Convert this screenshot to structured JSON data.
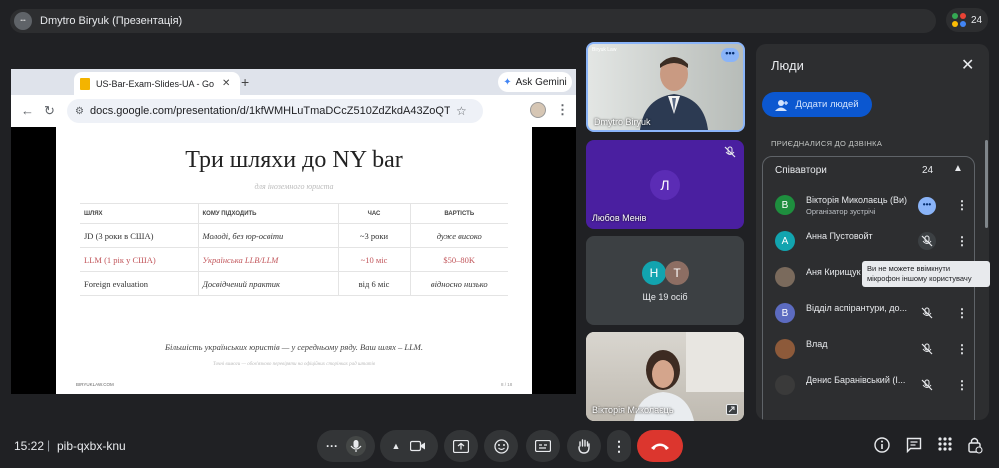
{
  "top_bar": {
    "presenter_label": "Dmytro Biryuk (Презентація)",
    "participant_count": "24"
  },
  "browser": {
    "tab_title": "US-Bar-Exam-Slides-UA - Go",
    "gemini_label": "Ask Gemini",
    "url": "docs.google.com/presentation/d/1kfWMHLuTmaDCcZ510ZdZkdA43ZoQTQ_Kd..."
  },
  "slide": {
    "title": "Три шляхи до NY bar",
    "subtitle": "для іноземного юриста",
    "headers": [
      "ШЛЯХ",
      "КОМУ ПІДХОДИТЬ",
      "ЧАС",
      "ВАРТІСТЬ"
    ],
    "rows": [
      [
        "JD (3 роки в США)",
        "Молоді, без юр-освіти",
        "~3 роки",
        "дуже високо"
      ],
      [
        "LLM (1 рік у США)",
        "Українська LLB/LLM",
        "~10 міс",
        "$50–80K"
      ],
      [
        "Foreign evaluation",
        "Досвідчений практик",
        "від 6 міс",
        "відносно низько"
      ]
    ],
    "footer_text": "Більшість українських юристів — у середньому ряду. Ваш шлях – LLM.",
    "note": "Точні вимоги — обов'язково перевіряти на офіційних сторінках рад штатів",
    "brand": "BIRYUKLAW.COM",
    "page": "8 / 18"
  },
  "tiles": [
    {
      "name": "Dmytro Biryuk",
      "label_small": "Biryuk Law"
    },
    {
      "name": "Любов Менів",
      "initial": "Л"
    },
    {
      "name": "Ще 19 осіб",
      "initials": [
        "Н",
        "Т"
      ]
    },
    {
      "name": "Вікторія Миколаєць"
    }
  ],
  "people_panel": {
    "title": "Люди",
    "add_people_label": "Додати людей",
    "joined_label": "ПРИЄДНАЛИСЯ ДО ДЗВІНКА",
    "group_title": "Співавтори",
    "group_count": "24",
    "people": [
      {
        "initial": "В",
        "name": "Вікторія Миколаєць (Ви)",
        "role": "Організатор зустрічі",
        "color": "#1e8e3e"
      },
      {
        "initial": "А",
        "name": "Анна Пустовойт",
        "role": "",
        "color": "#12a4af"
      },
      {
        "initial": "",
        "name": "Аня Кирищук",
        "role": "",
        "color": "#7a6a5c"
      },
      {
        "initial": "В",
        "name": "Відділ аспірантури, до...",
        "role": "",
        "color": "#5c6bc0"
      },
      {
        "initial": "",
        "name": "Влад",
        "role": "",
        "color": "#8d5a3a"
      },
      {
        "initial": "",
        "name": "Денис Баранівський (І...",
        "role": "",
        "color": "#3a3a3a"
      }
    ],
    "tooltip": "Ви не можете ввімкнути мікрофон іншому користувачу"
  },
  "bottom_bar": {
    "time": "15:22",
    "meeting_code": "pib-qxbx-knu"
  },
  "colors": {
    "background": "#202124",
    "accent_blue": "#0b57d0",
    "end_call_red": "#dc362e",
    "slide_highlight": "#c2575c"
  }
}
